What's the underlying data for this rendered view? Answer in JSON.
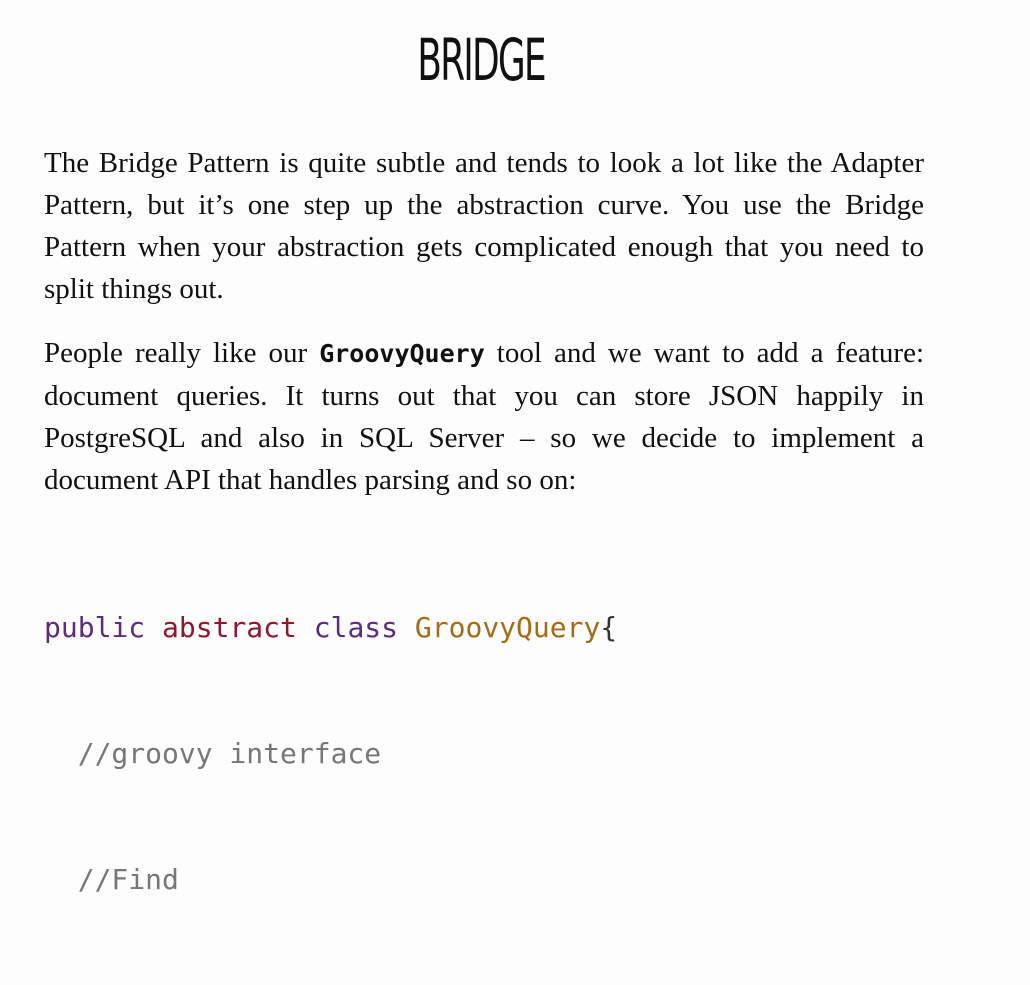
{
  "article": {
    "title": "BRIDGE",
    "paragraph1": "The Bridge Pattern is quite subtle and tends to look a lot like the Adapter Pattern, but it’s one step up the abstraction curve. You use the Bridge Pattern when your abstraction gets complicated enough that you need to split things out.",
    "paragraph2": {
      "before": "People really like our ",
      "code": "GroovyQuery",
      "after": " tool and we want to add a feature: document queries. It turns out that you can store JSON happily in PostgreSQL and also in SQL Server – so we decide to implement a document API that handles parsing and so on:"
    },
    "code": {
      "line1": {
        "kw1": "public",
        "kw2": "abstract",
        "kw3": "class",
        "class_name": "GroovyQuery",
        "brace": "{"
      },
      "line2": "  //groovy interface",
      "line3": "  //Find"
    }
  },
  "colors": {
    "keyword_purple": "#5b2d7a",
    "keyword_red": "#8b1a2f",
    "class_gold": "#a36c17",
    "comment_gray": "#777777"
  }
}
